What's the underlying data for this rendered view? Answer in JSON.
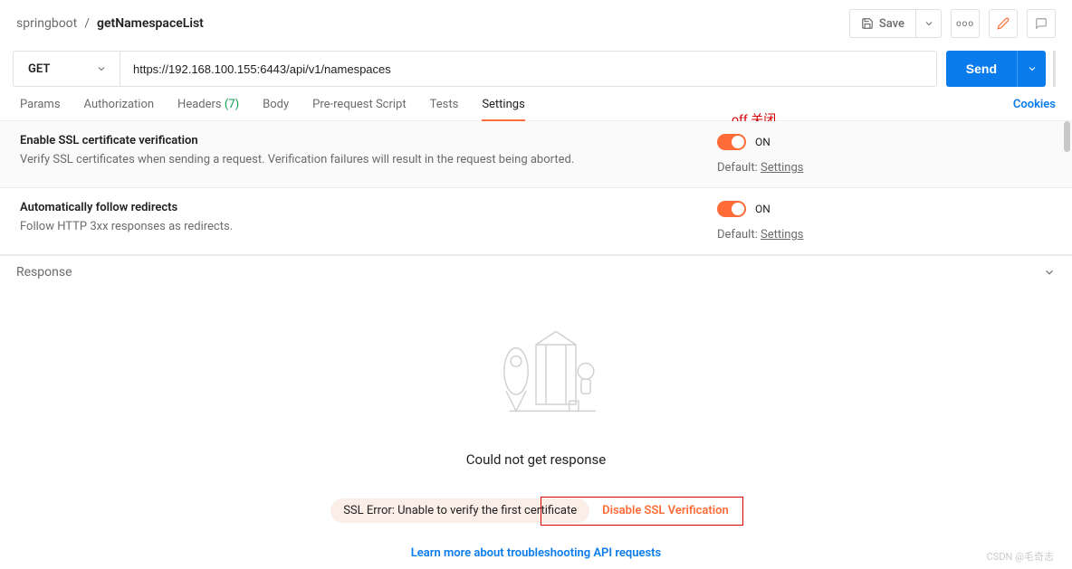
{
  "breadcrumb": {
    "collection": "springboot",
    "sep": "/",
    "request": "getNamespaceList"
  },
  "toolbar": {
    "save": "Save",
    "more": "ooo"
  },
  "request": {
    "method": "GET",
    "url": "https://192.168.100.155:6443/api/v1/namespaces",
    "send": "Send"
  },
  "tabs": {
    "params": "Params",
    "auth": "Authorization",
    "headers": "Headers",
    "headers_count": "(7)",
    "body": "Body",
    "prereq": "Pre-request Script",
    "tests": "Tests",
    "settings": "Settings",
    "cookies": "Cookies"
  },
  "annotations": {
    "off_note": "off 关闭"
  },
  "settings": {
    "ssl": {
      "title": "Enable SSL certificate verification",
      "desc": "Verify SSL certificates when sending a request. Verification failures will result in the request being aborted.",
      "state": "ON",
      "default_prefix": "Default: ",
      "default_link": "Settings"
    },
    "redirects": {
      "title": "Automatically follow redirects",
      "desc": "Follow HTTP 3xx responses as redirects.",
      "state": "ON",
      "default_prefix": "Default: ",
      "default_link": "Settings"
    }
  },
  "response": {
    "header": "Response",
    "no_response": "Could not get response",
    "error": "SSL Error: Unable to verify the first certificate",
    "disable": "Disable SSL Verification",
    "learn": "Learn more about troubleshooting API requests"
  },
  "watermark": "CSDN @毛奇志"
}
